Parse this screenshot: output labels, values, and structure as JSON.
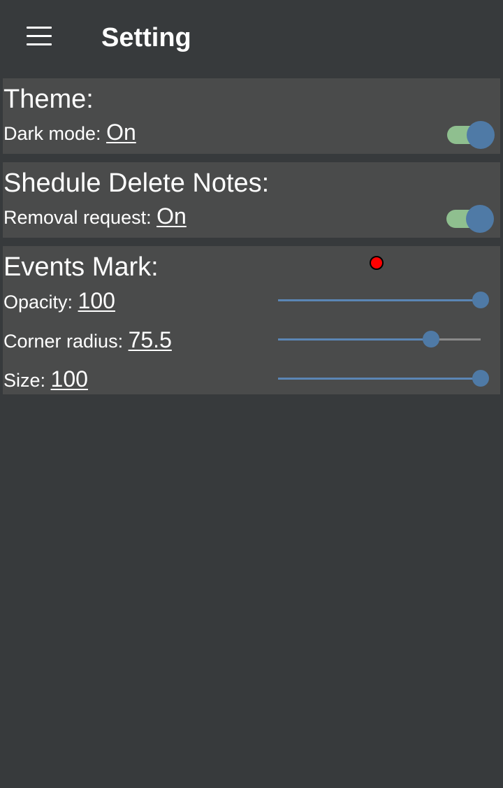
{
  "appbar": {
    "title": "Setting",
    "menu_icon": "hamburger-menu-icon"
  },
  "theme": {
    "title": "Theme:",
    "dark_mode_label": "Dark mode: ",
    "dark_mode_value": "On",
    "dark_mode_on": true
  },
  "schedule": {
    "title": "Shedule Delete Notes:",
    "removal_label": "Removal request: ",
    "removal_value": "On",
    "removal_on": true
  },
  "events_mark": {
    "title": "Events Mark:",
    "preview_color": "#ff0000",
    "opacity_label": "Opacity: ",
    "opacity_value": "100",
    "opacity_fraction": 1.0,
    "corner_label": "Corner radius: ",
    "corner_value": "75.5",
    "corner_fraction": 0.755,
    "size_label": "Size: ",
    "size_value": "100",
    "size_fraction": 1.0
  },
  "colors": {
    "background": "#373a3c",
    "card": "#4a4b4b",
    "accent": "#4f7aa6",
    "switch_track": "#8fbf8f"
  }
}
